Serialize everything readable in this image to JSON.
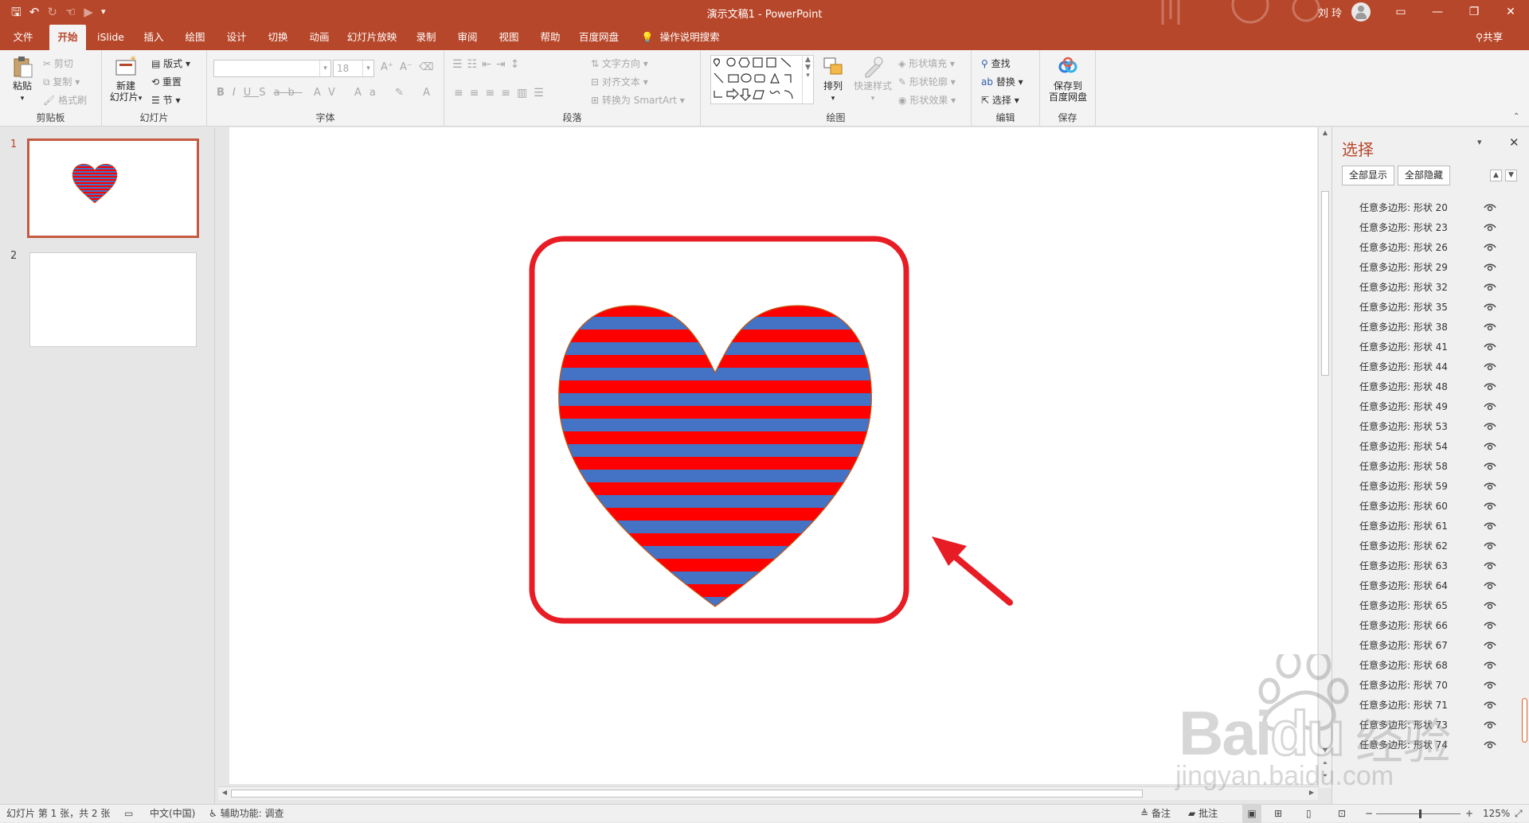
{
  "window": {
    "doc_title": "演示文稿1",
    "app_name": "PowerPoint",
    "title_separator": " - ",
    "user_name": "刘 玲"
  },
  "titlebar": {
    "min": "—",
    "restore": "❐",
    "close": "✕",
    "ribbon_display": "▭",
    "qat_more": "▾"
  },
  "tabs": [
    "文件",
    "开始",
    "iSlide",
    "插入",
    "绘图",
    "设计",
    "切换",
    "动画",
    "幻灯片放映",
    "录制",
    "审阅",
    "视图",
    "帮助",
    "百度网盘"
  ],
  "active_tab": "开始",
  "tell_me": "操作说明搜索",
  "share": "共享",
  "ribbon": {
    "clipboard": {
      "label": "剪贴板",
      "paste": "粘贴",
      "cut": "剪切",
      "copy": "复制",
      "format_painter": "格式刷"
    },
    "slides": {
      "label": "幻灯片",
      "new_slide_1": "新建",
      "new_slide_2": "幻灯片",
      "layout": "版式",
      "reset": "重置",
      "section": "节"
    },
    "font": {
      "label": "字体",
      "font_size": "18"
    },
    "paragraph": {
      "label": "段落",
      "text_direction": "文字方向",
      "align_text": "对齐文本",
      "smartart": "转换为 SmartArt"
    },
    "drawing": {
      "label": "绘图",
      "arrange": "排列",
      "quick_styles": "快速样式",
      "shape_fill": "形状填充",
      "shape_outline": "形状轮廓",
      "shape_effects": "形状效果"
    },
    "editing": {
      "label": "编辑",
      "find": "查找",
      "replace": "替换",
      "select": "选择"
    },
    "save": {
      "label": "保存",
      "save_1": "保存到",
      "save_2": "百度网盘"
    }
  },
  "slides": [
    {
      "number": "1"
    },
    {
      "number": "2"
    }
  ],
  "selection_pane": {
    "title": "选择",
    "show_all": "全部显示",
    "hide_all": "全部隐藏",
    "items": [
      "任意多边形: 形状 20",
      "任意多边形: 形状 23",
      "任意多边形: 形状 26",
      "任意多边形: 形状 29",
      "任意多边形: 形状 32",
      "任意多边形: 形状 35",
      "任意多边形: 形状 38",
      "任意多边形: 形状 41",
      "任意多边形: 形状 44",
      "任意多边形: 形状 48",
      "任意多边形: 形状 49",
      "任意多边形: 形状 53",
      "任意多边形: 形状 54",
      "任意多边形: 形状 58",
      "任意多边形: 形状 59",
      "任意多边形: 形状 60",
      "任意多边形: 形状 61",
      "任意多边形: 形状 62",
      "任意多边形: 形状 63",
      "任意多边形: 形状 64",
      "任意多边形: 形状 65",
      "任意多边形: 形状 66",
      "任意多边形: 形状 67",
      "任意多边形: 形状 68",
      "任意多边形: 形状 70",
      "任意多边形: 形状 71",
      "任意多边形: 形状 73",
      "任意多边形: 形状 74"
    ]
  },
  "status": {
    "slide_info": "幻灯片 第 1 张，共 2 张",
    "language": "中文(中国)",
    "accessibility": "辅助功能: 调查",
    "notes": "备注",
    "comments": "批注",
    "zoom_minus": "−",
    "zoom_plus": "+",
    "zoom": "125%"
  },
  "colors": {
    "accent": "#b7472a",
    "stripe_red": "#ff0000",
    "stripe_blue": "#4472c4",
    "annotation_red": "#e81c24"
  },
  "watermark": {
    "brand": "Bai",
    "brand_tail": "du",
    "tagline": "经验",
    "url": "jingyan.baidu.com"
  }
}
